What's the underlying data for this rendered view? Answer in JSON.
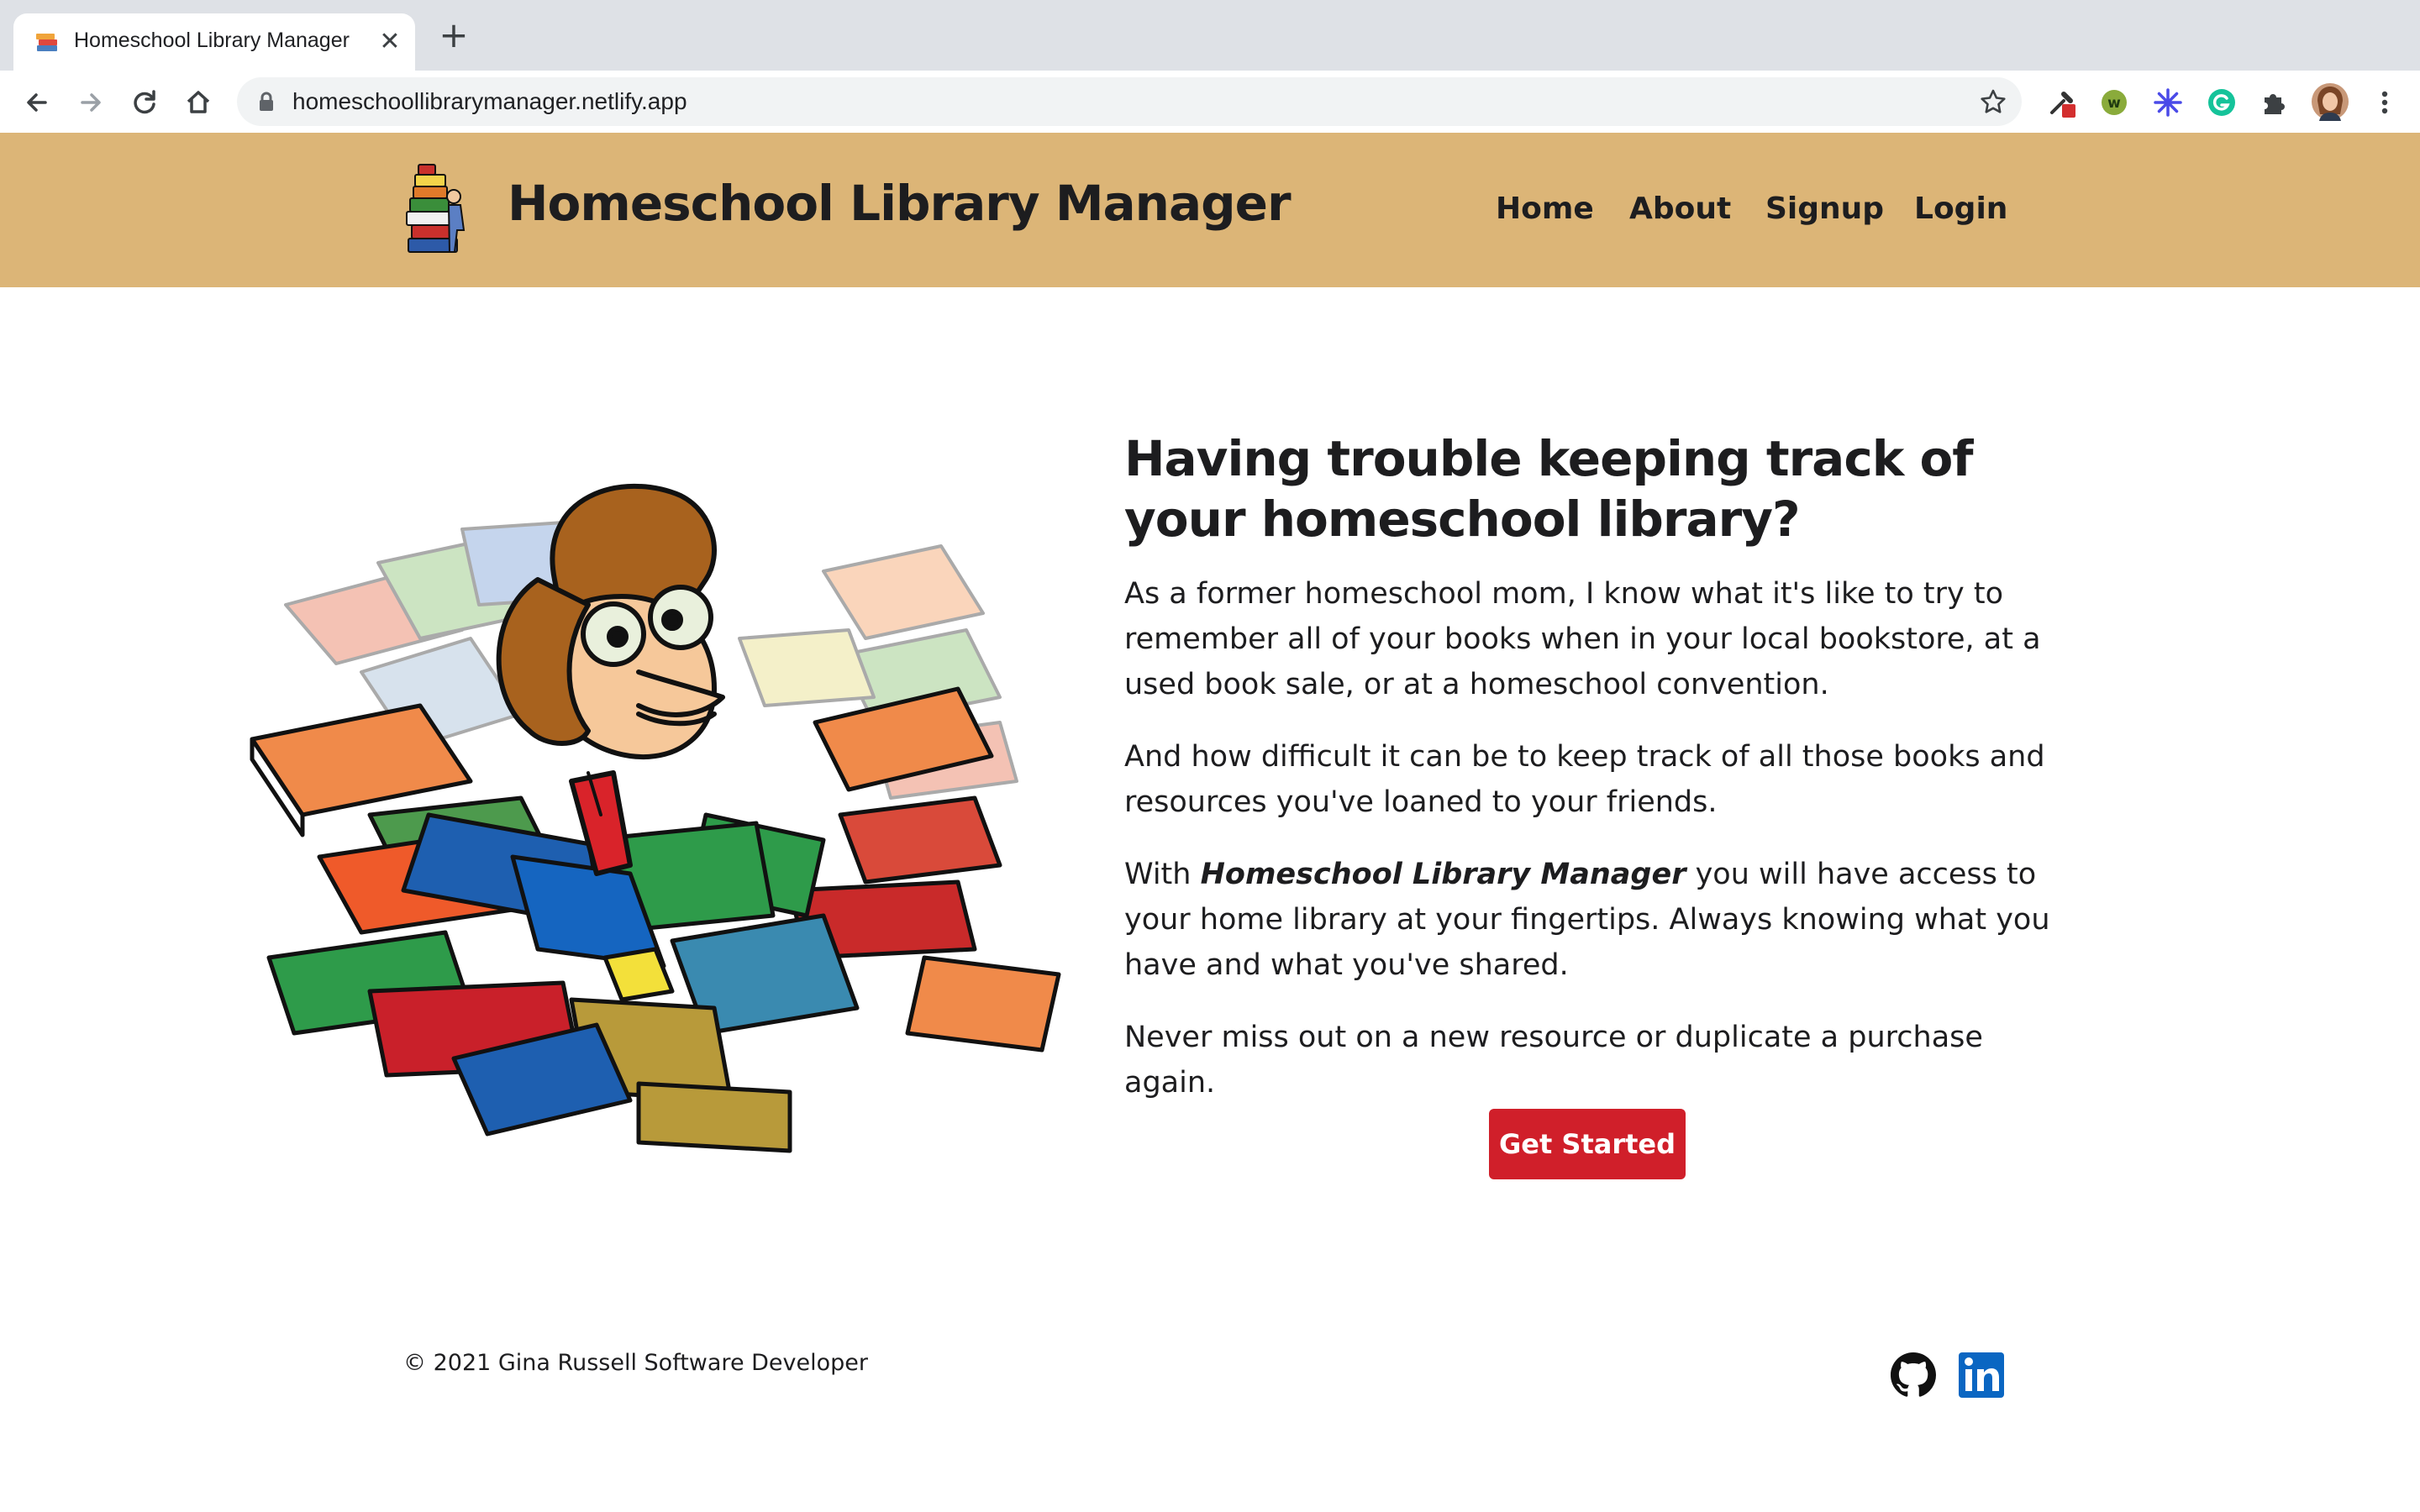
{
  "browser": {
    "tab": {
      "title": "Homeschool Library Manager",
      "favicon": "books-icon"
    },
    "new_tab": "+",
    "close": "✕",
    "url": "homeschoollibrarymanager.netlify.app",
    "nav_icons": [
      "back-icon",
      "forward-icon",
      "reload-icon",
      "home-icon"
    ],
    "extensions": [
      "eyedropper-extension-icon",
      "w-extension-icon",
      "sparkle-extension-icon",
      "grammarly-extension-icon",
      "puzzle-extensions-icon",
      "profile-avatar",
      "more-menu-icon"
    ]
  },
  "site": {
    "brand": "Homeschool Library Manager",
    "nav": {
      "home": "Home",
      "about": "About",
      "signup": "Signup",
      "login": "Login"
    },
    "header_color": "#dcb577"
  },
  "hero": {
    "heading": "Having trouble keeping track of your homeschool library?",
    "p1": "As a former homeschool mom, I know what it's like to try to remember all of your books when in your local bookstore, at a used book sale, or at a homeschool convention.",
    "p2": "And how difficult it can be to keep track of all those books and resources you've loaned to your friends.",
    "p3_prefix": "With",
    "p3_emphasis": "Homeschool Library Manager",
    "p3_suffix": "you will have access to your home library at your fingertips. Always knowing what you have and what you've shared.",
    "p4": "Never miss out on a new resource or duplicate a purchase again.",
    "cta": "Get Started",
    "cta_color": "#d01f2a"
  },
  "footer": {
    "copyright": "© 2021 Gina Russell Software Developer",
    "social": [
      "github-icon",
      "linkedin-icon"
    ]
  }
}
